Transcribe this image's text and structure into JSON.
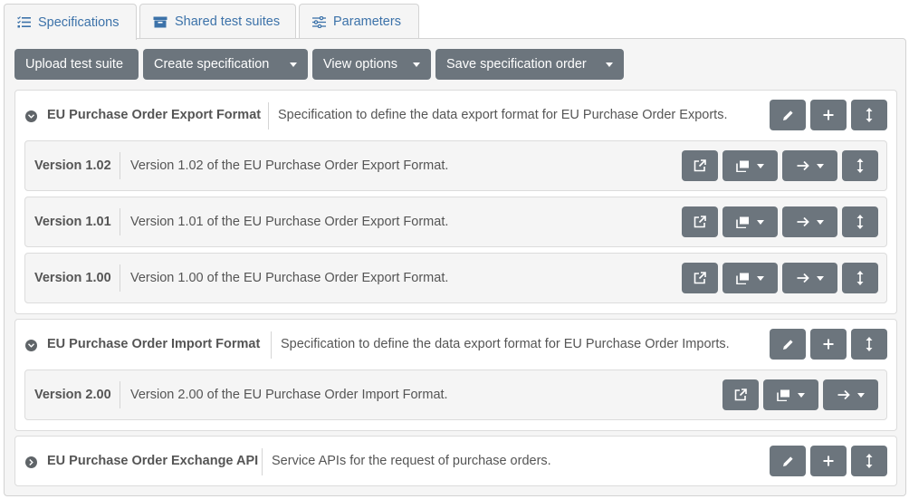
{
  "tabs": [
    {
      "label": "Specifications",
      "icon": "list-check-icon",
      "active": true
    },
    {
      "label": "Shared test suites",
      "icon": "archive-box-icon",
      "active": false
    },
    {
      "label": "Parameters",
      "icon": "sliders-icon",
      "active": false
    }
  ],
  "toolbar": {
    "upload_label": "Upload test suite",
    "create_label": "Create specification",
    "view_label": "View options",
    "save_order_label": "Save specification order"
  },
  "specifications": [
    {
      "title": "EU Purchase Order Export Format",
      "description": "Specification to define the data export format for EU Purchase Order Exports.",
      "expanded": true,
      "versions": [
        {
          "title": "Version 1.02",
          "description": "Version 1.02 of the EU Purchase Order Export Format."
        },
        {
          "title": "Version 1.01",
          "description": "Version 1.01 of the EU Purchase Order Export Format."
        },
        {
          "title": "Version 1.00",
          "description": "Version 1.00 of the EU Purchase Order Export Format."
        }
      ]
    },
    {
      "title": "EU Purchase Order Import Format",
      "description": "Specification to define the data export format for EU Purchase Order Imports.",
      "expanded": true,
      "versions": [
        {
          "title": "Version 2.00",
          "description": "Version 2.00 of the EU Purchase Order Import Format."
        }
      ]
    },
    {
      "title": "EU Purchase Order Exchange API",
      "description": "Service APIs for the request of purchase orders.",
      "expanded": false,
      "versions": []
    }
  ],
  "colors": {
    "link_blue": "#3c72a9",
    "button_gray": "#6c757d",
    "panel_bg": "#f5f5f5"
  }
}
